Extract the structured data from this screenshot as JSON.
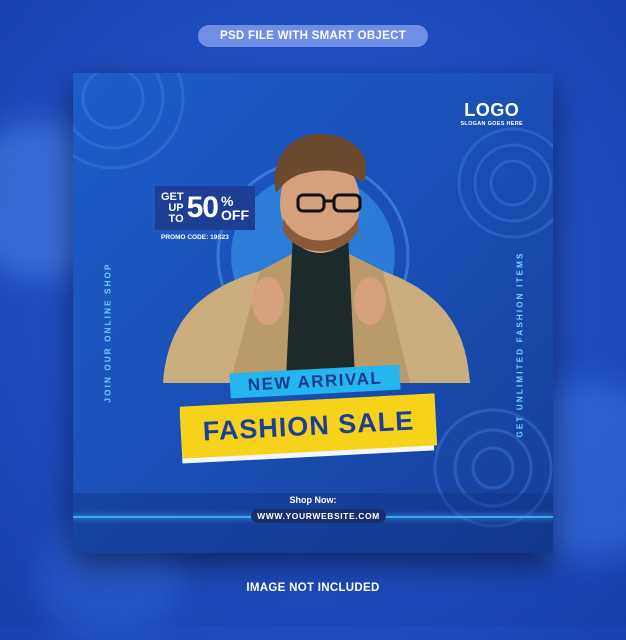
{
  "header": {
    "label": "PSD FILE WITH SMART OBJECT"
  },
  "footer": {
    "label": "IMAGE NOT INCLUDED"
  },
  "card": {
    "logo": {
      "word": "LOGO",
      "slogan": "SLOGAN GOES HERE"
    },
    "side_left": "JOIN OUR ONLINE SHOP",
    "side_right": "GET UNLIMITED FASHION ITEMS",
    "promo": {
      "get": "GET",
      "up": "UP",
      "to": "TO",
      "percent": "50",
      "pct_sign": "%",
      "off": "OFF",
      "code": "PROMO CODE: 19S23"
    },
    "arrival": "NEW ARRIVAL",
    "sale": "FASHION SALE",
    "shop_now": "Shop Now:",
    "url": "WWW.YOURWEBSITE.COM"
  },
  "colors": {
    "background": "#1f4fc4",
    "card": "#1a4fb6",
    "accent_blue": "#25b6f0",
    "accent_yellow": "#f7d21b",
    "navy": "#1b3f99"
  }
}
